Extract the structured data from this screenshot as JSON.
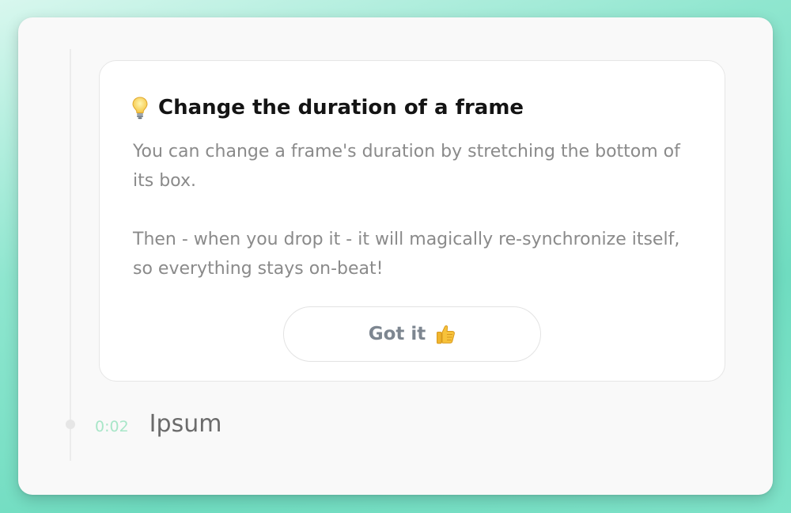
{
  "tip": {
    "icon": "lightbulb-icon",
    "title": "Change the duration of a frame",
    "paragraph1": "You can change a frame's duration by stretching the bottom of its box.",
    "paragraph2": "Then - when you drop it - it will magically re-synchronize itself, so everything stays on-beat!",
    "button_label": "Got it",
    "button_icon": "thumbs-up-icon"
  },
  "timeline": {
    "items": [
      {
        "timecode": "0:02",
        "title": "Ipsum"
      }
    ]
  },
  "colors": {
    "accent_green": "#a8e6c8",
    "background_teal": "#6fdcc0"
  }
}
